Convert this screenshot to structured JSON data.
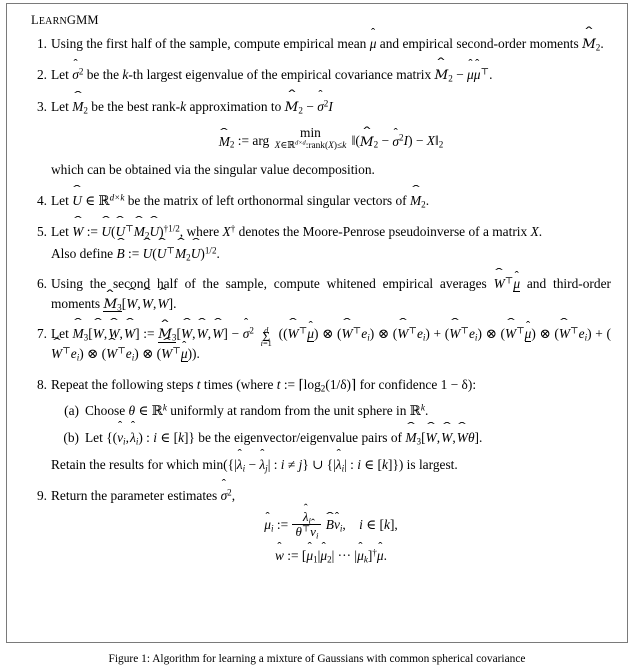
{
  "document": {
    "type": "algorithm-figure",
    "algorithm_title": "LearnGMM",
    "caption": "Figure 1: Algorithm for learning a mixture of Gaussians with common spherical covariance"
  },
  "steps": [
    {
      "number": "1.",
      "text": "Using the first half of the sample, compute empirical mean μ̂ and empirical second-order moments M̂₂."
    },
    {
      "number": "2.",
      "text": "Let σ̂² be the k-th largest eigenvalue of the empirical covariance matrix M̂₂ − μ̂μ̂ᵀ."
    },
    {
      "number": "3.",
      "text": "Let M̂₂ be the best rank-k approximation to M̂₂ − σ̂²I",
      "display_equation": "M̂₂ := arg min over X ∈ R^{d×d}: rank(X) ≤ k of ‖(M̂₂ − σ̂²I) − X‖₂",
      "text_after": "which can be obtained via the singular value decomposition."
    },
    {
      "number": "4.",
      "text": "Let Û ∈ R^{d×k} be the matrix of left orthonormal singular vectors of M̂₂."
    },
    {
      "number": "5.",
      "text": "Let Ŵ := Û(ÛᵀM̂₂Û)^{†1/2}, where X† denotes the Moore-Penrose pseudoinverse of a matrix X.",
      "text_after": "Also define B̂ := Û(ÛᵀM̂₂Û)^{1/2}."
    },
    {
      "number": "6.",
      "text": "Using the second half of the sample, compute whitened empirical averages Ŵᵀμ̂ and third-order moments M̂₃[Ŵ, Ŵ, Ŵ]."
    },
    {
      "number": "7.",
      "text": "Let M̂₃[Ŵ, Ŵ, Ŵ] := M̂₃[Ŵ, Ŵ, Ŵ] − σ̂² Σ_{i=1}^{d} ((Ŵᵀμ̂) ⊗ (Ŵᵀe_i) ⊗ (Ŵᵀe_i) + (Ŵᵀe_i) ⊗ (Ŵᵀμ̂) ⊗ (Ŵᵀe_i) + (Ŵᵀe_i) ⊗ (Ŵᵀe_i) ⊗ (Ŵᵀμ̂))."
    },
    {
      "number": "8.",
      "text": "Repeat the following steps t times (where t := ⌈log₂(1/δ)⌉ for confidence 1 − δ):",
      "substeps": [
        {
          "number": "(a)",
          "text": "Choose θ ∈ R^k uniformly at random from the unit sphere in R^k."
        },
        {
          "number": "(b)",
          "text": "Let {(v̂_i, λ̂_i) : i ∈ [k]} be the eigenvector/eigenvalue pairs of M̂₃[Ŵ, Ŵ, Ŵθ]."
        }
      ],
      "text_after": "Retain the results for which min({|λ̂_i − λ̂_j| : i ≠ j} ∪ {|λ̂_i| : i ∈ [k]}) is largest."
    },
    {
      "number": "9.",
      "text": "Return the parameter estimates σ̂²,",
      "display_equations": [
        "μ̂_i := (λ̂_i / (θᵀv̂_i)) B̂v̂_i,   i ∈ [k],",
        "ŵ := [μ̂₁|μ̂₂| ⋯ |μ̂_k]† μ̂."
      ]
    }
  ],
  "colors": {
    "page_background": "#ffffff",
    "text": "#000000",
    "box_border": "#7a7a7a"
  }
}
